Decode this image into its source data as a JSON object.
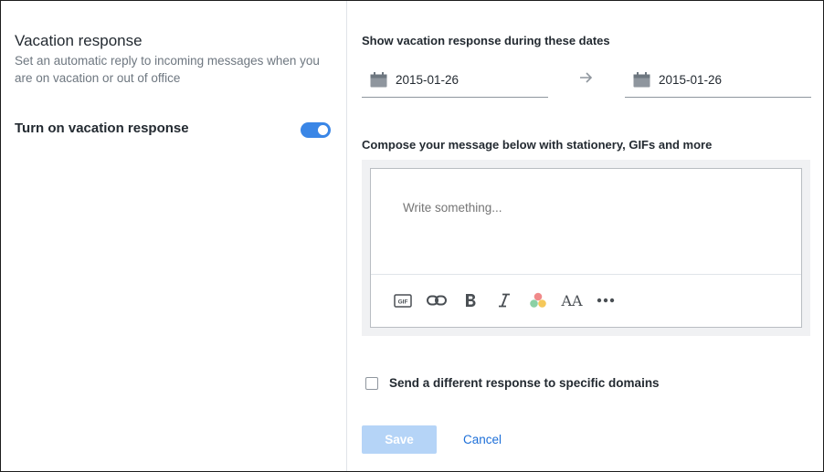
{
  "left": {
    "title": "Vacation response",
    "description": "Set an automatic reply to incoming messages when you are on vacation or out of office",
    "toggle_label": "Turn on vacation response",
    "toggle_on": true
  },
  "dates": {
    "label": "Show vacation response during these dates",
    "start": "2015-01-26",
    "end": "2015-01-26"
  },
  "compose": {
    "label": "Compose your message below with stationery, GIFs and more",
    "placeholder": "Write something...",
    "toolbar": {
      "gif": "GIF",
      "font_size": "AA",
      "icons": [
        "gif-icon",
        "link-icon",
        "bold-icon",
        "italic-icon",
        "color-palette-icon",
        "font-size-icon",
        "more-icon"
      ]
    }
  },
  "domains": {
    "label": "Send a different response to specific domains",
    "checked": false
  },
  "actions": {
    "save": "Save",
    "cancel": "Cancel"
  },
  "colors": {
    "accent": "#1d6fd8",
    "toggle": "#3a86e6",
    "save_disabled": "#b5d4f7"
  }
}
